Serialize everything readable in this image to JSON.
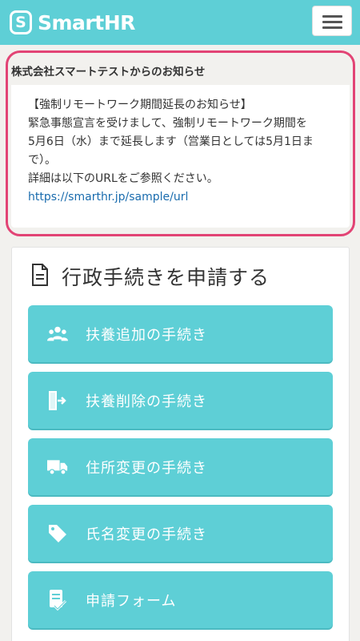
{
  "header": {
    "brand_mark": "S",
    "brand_name": "SmartHR",
    "menu_icon": "hamburger-menu-icon"
  },
  "notice": {
    "title": "株式会社スマートテストからのお知らせ",
    "lines": [
      "【強制リモートワーク期間延長のお知らせ】",
      "緊急事態宣言を受けまして、強制リモートワーク期間を",
      "5月6日（水）まで延長します（営業日としては5月1日ま",
      "で）。",
      "詳細は以下のURLをご参照ください。"
    ],
    "link": "https://smarthr.jp/sample/url",
    "highlight_color": "#e24475"
  },
  "procedures": {
    "heading": "行政手続きを申請する",
    "heading_icon": "document-icon",
    "items": [
      {
        "label": "扶養追加の手続き",
        "icon": "users-icon"
      },
      {
        "label": "扶養削除の手続き",
        "icon": "door-exit-icon"
      },
      {
        "label": "住所変更の手続き",
        "icon": "truck-icon"
      },
      {
        "label": "氏名変更の手続き",
        "icon": "tag-icon"
      },
      {
        "label": "申請フォーム",
        "icon": "form-check-icon"
      }
    ]
  },
  "colors": {
    "brand": "#5ecfd6",
    "background": "#f2f1ee",
    "link": "#1a6cae"
  }
}
